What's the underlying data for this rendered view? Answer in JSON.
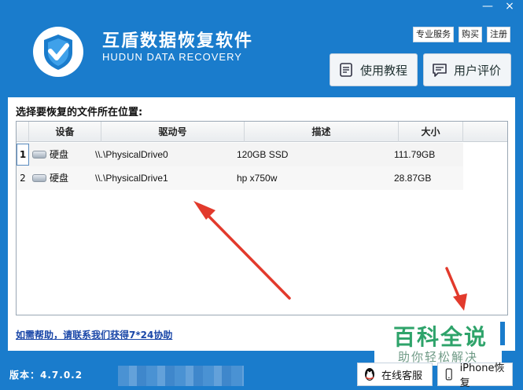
{
  "window": {
    "minimize_glyph": "—",
    "close_glyph": "×"
  },
  "header": {
    "title": "互盾数据恢复软件",
    "subtitle": "HUDUN DATA RECOVERY",
    "links": [
      "专业服务",
      "购买",
      "注册"
    ],
    "tutorial_label": "使用教程",
    "review_label": "用户评价"
  },
  "panel": {
    "title": "选择要恢复的文件所在位置:",
    "columns": [
      "设备",
      "驱动号",
      "描述",
      "大小"
    ],
    "rows": [
      {
        "index": "1",
        "device": "硬盘",
        "drive": "\\\\.\\PhysicalDrive0",
        "desc": "120GB SSD",
        "size": "111.79GB"
      },
      {
        "index": "2",
        "device": "硬盘",
        "drive": "\\\\.\\PhysicalDrive1",
        "desc": "hp x750w",
        "size": "28.87GB"
      }
    ],
    "help_link": "如需帮助，请联系我们获得7*24协助"
  },
  "watermark": {
    "main": "百科全说",
    "sub": "助你轻松解决"
  },
  "footer": {
    "version": "版本：4.7.0.2",
    "service_label": "在线客服",
    "iphone_label": "iPhone恢复"
  },
  "colors": {
    "window_blue": "#1a7ccc",
    "arrow_red": "#e23a2c",
    "watermark_green": "#2ea36a"
  }
}
